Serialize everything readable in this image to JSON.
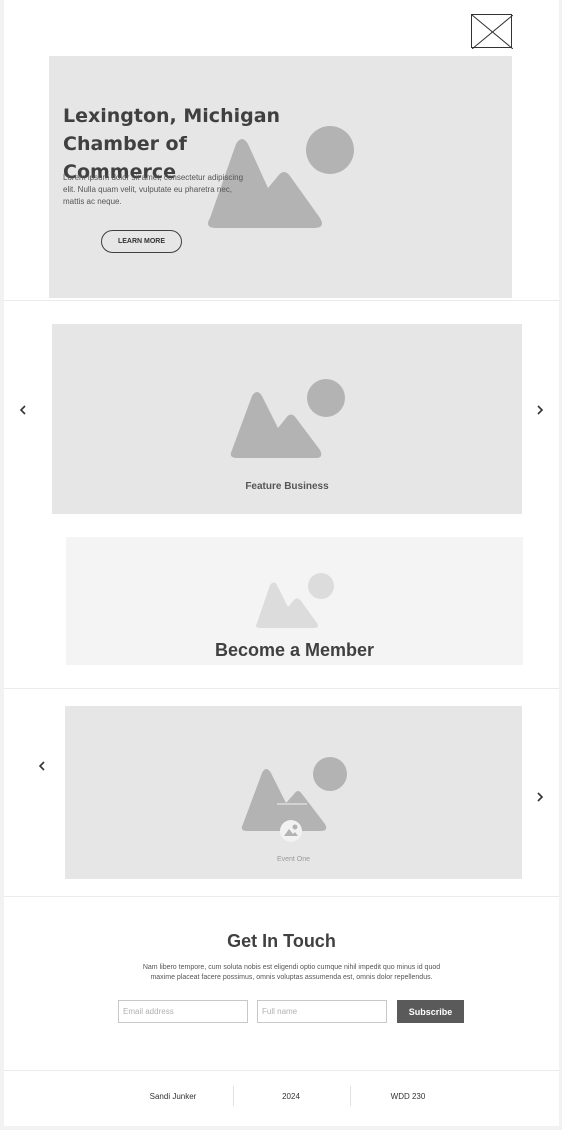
{
  "header": {
    "logo_icon": "image-placeholder-icon"
  },
  "hero": {
    "title": "Lexington, Michigan Chamber of Commerce",
    "text": "Lorem ipsum dolor sit amet, consectetur adipiscing elit. Nulla quam velit, vulputate eu pharetra nec, mattis ac neque.",
    "button_label": "LEARN MORE"
  },
  "feature": {
    "label": "Feature Business",
    "prev_icon": "chevron-left-icon",
    "next_icon": "chevron-right-icon"
  },
  "member": {
    "title": "Become a Member"
  },
  "events": {
    "label": "Event One",
    "prev_icon": "chevron-left-icon",
    "next_icon": "chevron-right-icon"
  },
  "contact": {
    "title": "Get In Touch",
    "text": "Nam libero tempore, cum soluta nobis est eligendi optio cumque nihil impedit quo minus id quod maxime placeat facere possimus, omnis voluptas assumenda est, omnis dolor repellendus.",
    "email_placeholder": "Email address",
    "name_placeholder": "Full name",
    "subscribe_label": "Subscribe"
  },
  "footer": {
    "author": "Sandi Junker",
    "year": "2024",
    "course": "WDD 230"
  },
  "colors": {
    "placeholder_bg": "#e6e6e6",
    "placeholder_shape": "#b3b3b3",
    "button_dark": "#5a5a5a"
  }
}
